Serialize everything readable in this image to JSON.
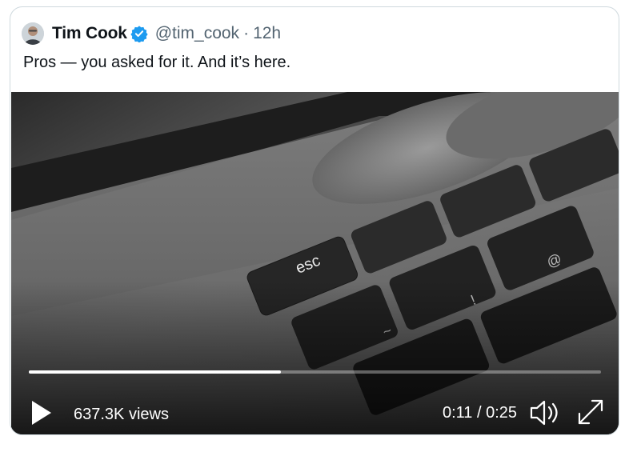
{
  "tweet": {
    "author_name": "Tim Cook",
    "handle": "@tim_cook",
    "time": "12h",
    "text": "Pros — you asked for it. And it’s here."
  },
  "video": {
    "views": "637.3K views",
    "time_display": "0:11 / 0:25",
    "progress": 0.44,
    "key_labels": {
      "esc": "esc"
    }
  },
  "icons": {
    "verified": "verified-badge-icon",
    "play": "play-icon",
    "volume": "volume-icon",
    "fullscreen": "fullscreen-icon"
  },
  "colors": {
    "verified_blue": "#1d9bf0",
    "handle_gray": "#536471",
    "border": "#cfd9de"
  }
}
